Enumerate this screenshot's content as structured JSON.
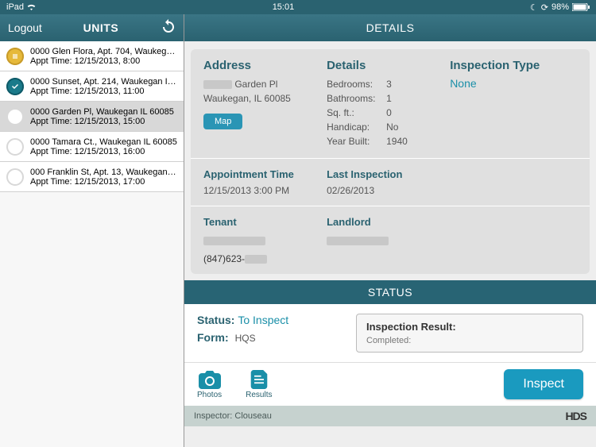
{
  "statusBar": {
    "device": "iPad",
    "time": "15:01",
    "battery": "98%"
  },
  "sidebar": {
    "logout": "Logout",
    "title": "UNITS",
    "items": [
      {
        "title": "0000 Glen Flora, Apt. 704, Waukegan...",
        "sub": "Appt Time:  12/15/2013, 8:00",
        "status": "gold"
      },
      {
        "title": "0000 Sunset, Apt. 214, Waukegan IL...",
        "sub": "Appt Time:  12/15/2013, 11:00",
        "status": "teal"
      },
      {
        "title": "0000 Garden Pl, Waukegan IL 60085",
        "sub": "Appt Time:  12/15/2013, 15:00",
        "status": "empty",
        "selected": true
      },
      {
        "title": "0000 Tamara Ct., Waukegan IL 60085",
        "sub": "Appt Time:  12/15/2013, 16:00",
        "status": "empty"
      },
      {
        "title": "000 Franklin St, Apt. 13, Waukegan IL...",
        "sub": "Appt Time:  12/15/2013, 17:00",
        "status": "empty"
      }
    ]
  },
  "detailsHeader": "DETAILS",
  "address": {
    "label": "Address",
    "line1": "Garden Pl",
    "line2": "Waukegan, IL 60085",
    "mapBtn": "Map"
  },
  "detailsKV": {
    "label": "Details",
    "rows": [
      {
        "k": "Bedrooms:",
        "v": "3"
      },
      {
        "k": "Bathrooms:",
        "v": "1"
      },
      {
        "k": "Sq. ft.:",
        "v": "0"
      },
      {
        "k": "Handicap:",
        "v": "No"
      },
      {
        "k": "Year Built:",
        "v": "1940"
      }
    ]
  },
  "inspectionType": {
    "label": "Inspection Type",
    "value": "None"
  },
  "appointment": {
    "label": "Appointment Time",
    "value": "12/15/2013 3:00 PM"
  },
  "lastInspection": {
    "label": "Last Inspection",
    "value": "02/26/2013"
  },
  "tenant": {
    "label": "Tenant",
    "phone": "(847)623-"
  },
  "landlord": {
    "label": "Landlord"
  },
  "statusBand": "STATUS",
  "status": {
    "statusLabel": "Status:",
    "statusValue": "To Inspect",
    "formLabel": "Form:",
    "formValue": "HQS",
    "resultTitle": "Inspection Result:",
    "resultCompleted": "Completed:"
  },
  "actions": {
    "photos": "Photos",
    "results": "Results",
    "inspect": "Inspect"
  },
  "footer": {
    "inspectorLabel": "Inspector:",
    "inspectorName": "Clouseau",
    "logo": "HDS"
  }
}
